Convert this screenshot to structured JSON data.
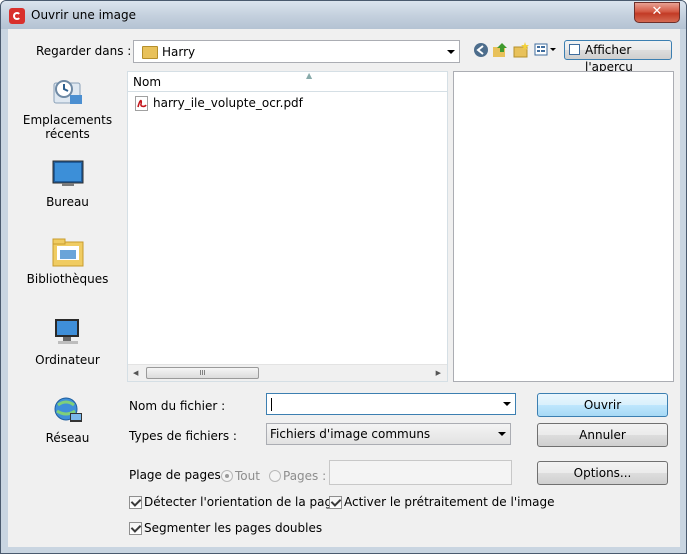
{
  "window": {
    "title": "Ouvrir une image",
    "close_label": "✕"
  },
  "toolbar": {
    "lookin_label": "Regarder dans :",
    "lookin_value": "Harry",
    "preview_button": "Afficher l'aperçu"
  },
  "places": [
    {
      "label_line1": "Emplacements",
      "label_line2": "récents",
      "icon": "recent-places-icon"
    },
    {
      "label_line1": "Bureau",
      "label_line2": "",
      "icon": "desktop-icon"
    },
    {
      "label_line1": "Bibliothèques",
      "label_line2": "",
      "icon": "libraries-icon"
    },
    {
      "label_line1": "Ordinateur",
      "label_line2": "",
      "icon": "computer-icon"
    },
    {
      "label_line1": "Réseau",
      "label_line2": "",
      "icon": "network-icon"
    }
  ],
  "filelist": {
    "column_name": "Nom",
    "files": [
      {
        "name": "harry_ile_volupte_ocr.pdf",
        "icon": "pdf-icon"
      }
    ],
    "scroll_grip": "III"
  },
  "form": {
    "filename_label": "Nom du fichier :",
    "filename_value": "",
    "filetype_label": "Types de fichiers :",
    "filetype_value": "Fichiers d'image communs",
    "pagerange_label": "Plage de pages :",
    "radio_all": "Tout",
    "radio_pages": "Pages :",
    "pages_value": "",
    "check_orientation": "Détecter l'orientation de la page",
    "check_preprocess": "Activer le prétraitement de l'image",
    "check_split": "Segmenter les pages doubles"
  },
  "buttons": {
    "open": "Ouvrir",
    "cancel": "Annuler",
    "options": "Options..."
  },
  "colors": {
    "accent": "#3c7fb1",
    "close": "#c23a25",
    "pdf": "#c4161c"
  }
}
